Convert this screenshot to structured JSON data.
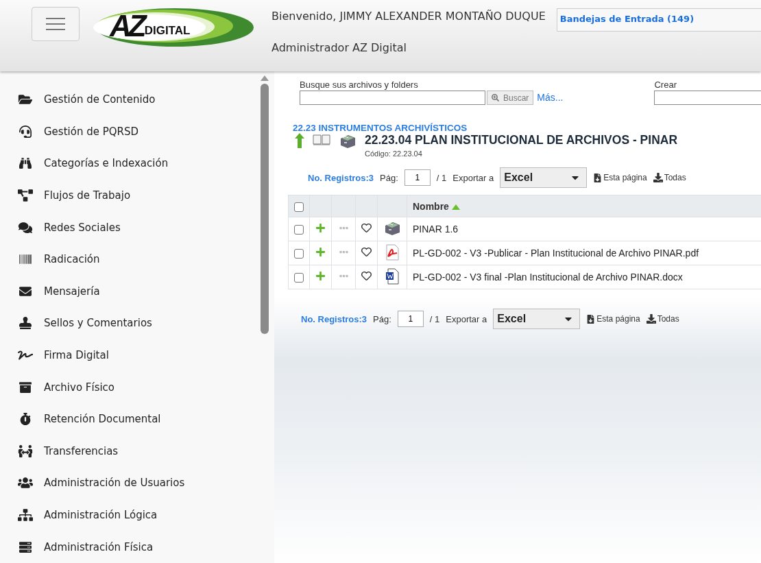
{
  "header": {
    "logo": {
      "main": "AZ",
      "sub": "DIGITAL"
    },
    "welcome": "Bienvenido, JIMMY ALEXANDER MONTAÑO DUQUE",
    "role": "Administrador AZ Digital",
    "inbox": "Bandejas de Entrada (149)"
  },
  "sidebar": {
    "items": [
      {
        "label": "Gestión de Contenido"
      },
      {
        "label": "Gestión de PQRSD"
      },
      {
        "label": "Categorías e Indexación"
      },
      {
        "label": "Flujos de Trabajo"
      },
      {
        "label": "Redes Sociales"
      },
      {
        "label": "Radicación"
      },
      {
        "label": "Mensajería"
      },
      {
        "label": "Sellos y Comentarios"
      },
      {
        "label": "Firma Digital"
      },
      {
        "label": "Archivo Físico"
      },
      {
        "label": "Retención Documental"
      },
      {
        "label": "Transferencias"
      },
      {
        "label": "Administración de Usuarios"
      },
      {
        "label": "Administración Lógica"
      },
      {
        "label": "Administración Física"
      }
    ]
  },
  "search": {
    "label": "Busque sus archivos y folders",
    "button": "Buscar",
    "more": "Más...",
    "create_label": "Crear"
  },
  "folder": {
    "breadcrumb": "22.23 INSTRUMENTOS ARCHIVÍSTICOS",
    "title": "22.23.04 PLAN INSTITUCIONAL DE ARCHIVOS - PINAR",
    "code": "Código: 22.23.04"
  },
  "pagers": [
    {
      "records": "No. Registros:3",
      "page_label": "Pág:",
      "page": "1",
      "pages": "/ 1",
      "export_label": "Exportar a",
      "format": "Excel",
      "this_page": "Esta página",
      "all": "Todas"
    },
    {
      "records": "No. Registros:3",
      "page_label": "Pág:",
      "page": "1",
      "pages": "/ 1",
      "export_label": "Exportar a",
      "format": "Excel",
      "this_page": "Esta página",
      "all": "Todas"
    }
  ],
  "table": {
    "header_checked": false,
    "columns": [
      "Nombre"
    ],
    "rows": [
      {
        "checked": false,
        "kind": "folder",
        "name": "PINAR 1.6"
      },
      {
        "checked": false,
        "kind": "pdf",
        "name": "PL-GD-002 - V3 -Publicar - Plan Institucional de Archivo PINAR.pdf"
      },
      {
        "checked": false,
        "kind": "word",
        "name": "PL-GD-002 - V3 final -Plan Institucional de Archivo PINAR.docx"
      }
    ]
  }
}
